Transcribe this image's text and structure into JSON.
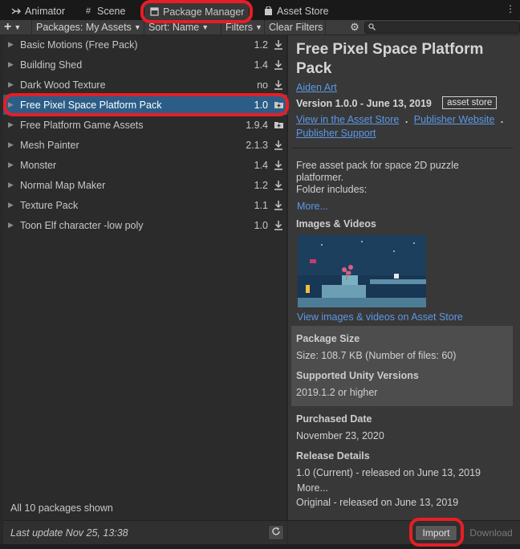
{
  "tabs": [
    {
      "label": "Animator",
      "icon": "animator-icon"
    },
    {
      "label": "Scene",
      "icon": "scene-grid-icon"
    },
    {
      "label": "Package Manager",
      "icon": "package-icon"
    },
    {
      "label": "Asset Store",
      "icon": "asset-store-bag-icon"
    }
  ],
  "toolbar": {
    "add_label": "+",
    "packages_label": "Packages: My Assets",
    "sort_label": "Sort: Name",
    "filters_label": "Filters",
    "clear_filters_label": "Clear Filters",
    "search_placeholder": ""
  },
  "packages": [
    {
      "name": "Basic Motions (Free Pack)",
      "version": "1.2",
      "action": "download-icon"
    },
    {
      "name": "Building Shed",
      "version": "1.4",
      "action": "download-icon"
    },
    {
      "name": "Dark Wood Texture",
      "version": "no",
      "action": "download-icon"
    },
    {
      "name": "Free Pixel Space Platform Pack",
      "version": "1.0",
      "action": "import-icon",
      "selected": true
    },
    {
      "name": "Free Platform Game Assets",
      "version": "1.9.4",
      "action": "import-icon"
    },
    {
      "name": "Mesh Painter",
      "version": "2.1.3",
      "action": "download-icon"
    },
    {
      "name": "Monster",
      "version": "1.4",
      "action": "download-icon"
    },
    {
      "name": "Normal Map Maker",
      "version": "1.2",
      "action": "download-icon"
    },
    {
      "name": "Texture Pack",
      "version": "1.1",
      "action": "download-icon"
    },
    {
      "name": "Toon Elf character -low poly",
      "version": "1.0",
      "action": "download-icon"
    }
  ],
  "list_footer": {
    "count_text": "All 10 packages shown",
    "last_update": "Last update Nov 25, 13:38"
  },
  "detail": {
    "title": "Free Pixel Space Platform Pack",
    "author": "Aiden Art",
    "version_line": "Version 1.0.0 - June 13, 2019",
    "badge": "asset store",
    "link_asset_store": "View in the Asset Store",
    "link_publisher_website": "Publisher Website",
    "link_publisher_support": "Publisher Support",
    "description": "Free asset pack for space 2D puzzle platformer.\nFolder includes:",
    "more_label": "More...",
    "images_heading": "Images & Videos",
    "view_media_link": "View images & videos on Asset Store",
    "package_size_heading": "Package Size",
    "package_size_value": "Size: 108.7 KB (Number of files: 60)",
    "unity_versions_heading": "Supported Unity Versions",
    "unity_versions_value": "2019.1.2 or higher",
    "purchased_heading": "Purchased Date",
    "purchased_value": "November 23, 2020",
    "release_heading": "Release Details",
    "release_current": "1.0 (Current) - released on June 13, 2019",
    "release_more": "More...",
    "release_original": "Original - released on June 13, 2019"
  },
  "buttons": {
    "import": "Import",
    "download": "Download"
  },
  "colors": {
    "selection": "#2c5d87",
    "link": "#5c98e6",
    "highlight": "#e61e25"
  }
}
